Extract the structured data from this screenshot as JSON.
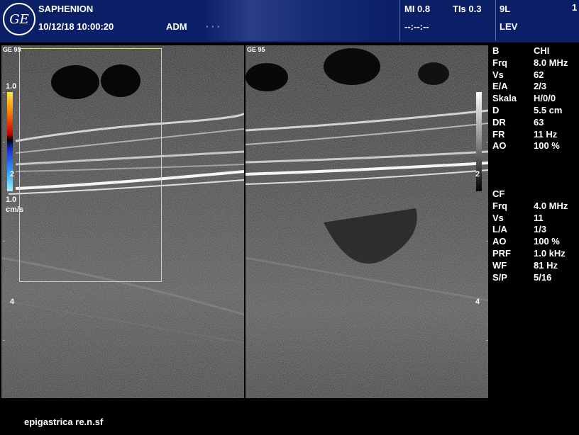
{
  "header": {
    "logo_text": "GE",
    "system": "SAPHENION",
    "datetime": "10/12/18 10:00:20",
    "operator": "ADM",
    "patient": "· · ·",
    "mi": "MI 0.8",
    "tis": "TIs 0.3",
    "probe": "9L",
    "page_number": "1",
    "time_placeholder": "--:--:--",
    "preset": "LEV"
  },
  "left_image": {
    "corner_label": "GE 95",
    "scale_top": "1.0",
    "scale_mid": "2",
    "scale_bottom": "1.0",
    "scale_unit": "cm/s",
    "depth_label": "4"
  },
  "right_image": {
    "corner_label": "GE 95",
    "gray_mid": "2",
    "depth_label": "4"
  },
  "b_mode": [
    {
      "key": "B",
      "value": "CHI"
    },
    {
      "key": "Frq",
      "value": "8.0 MHz"
    },
    {
      "key": "Vs",
      "value": "62"
    },
    {
      "key": "E/A",
      "value": "2/3"
    },
    {
      "key": "Skala",
      "value": "H/0/0"
    },
    {
      "key": "D",
      "value": "5.5 cm"
    },
    {
      "key": "DR",
      "value": "63"
    },
    {
      "key": "FR",
      "value": "11 Hz"
    },
    {
      "key": "AO",
      "value": "100 %"
    }
  ],
  "cf_mode": [
    {
      "key": "CF",
      "value": ""
    },
    {
      "key": "Frq",
      "value": "4.0 MHz"
    },
    {
      "key": "Vs",
      "value": "11"
    },
    {
      "key": "L/A",
      "value": "1/3"
    },
    {
      "key": "AO",
      "value": "100 %"
    },
    {
      "key": "PRF",
      "value": "1.0 kHz"
    },
    {
      "key": "WF",
      "value": "81 Hz"
    },
    {
      "key": "S/P",
      "value": "5/16"
    }
  ],
  "caption": "epigastrica re.n.sf",
  "colors": {
    "header_bg": "#0b1f66",
    "roi_border": "#d8d48a"
  }
}
